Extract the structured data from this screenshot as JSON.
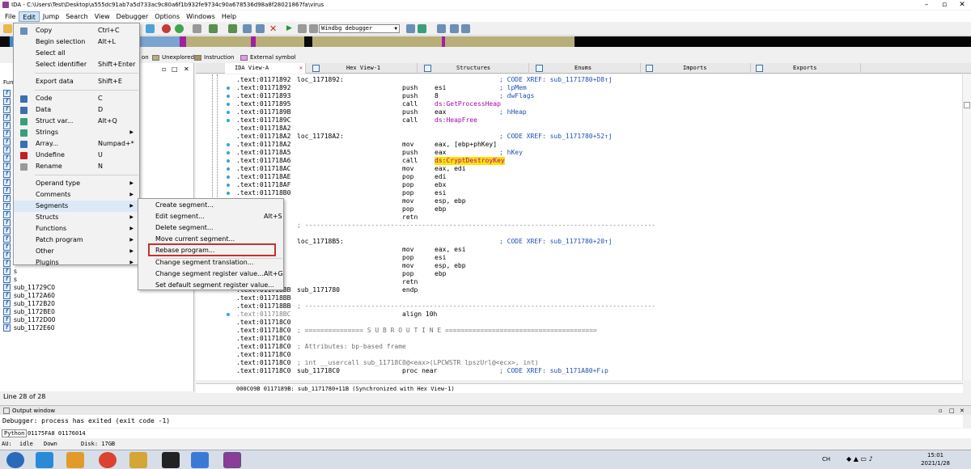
{
  "window": {
    "title": "IDA - C:\\Users\\Test\\Desktop\\a555dc91ab7a5d733ac9c80a6f1b932fe9734c90a678536d98a8f28021867fa\\virus"
  },
  "menubar": [
    "File",
    "Edit",
    "Jump",
    "Search",
    "View",
    "Debugger",
    "Options",
    "Windows",
    "Help"
  ],
  "toolbar": {
    "debugger_select": "Windbg debugger"
  },
  "legend": [
    "on",
    "Unexplored",
    "Instruction",
    "External symbol"
  ],
  "edit_menu": [
    {
      "label": "Copy",
      "shortcut": "Ctrl+C"
    },
    {
      "label": "Begin selection",
      "shortcut": "Alt+L"
    },
    {
      "label": "Select all",
      "shortcut": ""
    },
    {
      "label": "Select identifier",
      "shortcut": "Shift+Enter"
    },
    {
      "label": "Export data",
      "shortcut": "Shift+E"
    },
    {
      "label": "Code",
      "shortcut": "C"
    },
    {
      "label": "Data",
      "shortcut": "D"
    },
    {
      "label": "Struct var...",
      "shortcut": "Alt+Q"
    },
    {
      "label": "Strings",
      "shortcut": ""
    },
    {
      "label": "Array...",
      "shortcut": "Numpad+*"
    },
    {
      "label": "Undefine",
      "shortcut": "U"
    },
    {
      "label": "Rename",
      "shortcut": "N"
    },
    {
      "label": "Operand type",
      "shortcut": ""
    },
    {
      "label": "Comments",
      "shortcut": ""
    },
    {
      "label": "Segments",
      "shortcut": ""
    },
    {
      "label": "Structs",
      "shortcut": ""
    },
    {
      "label": "Functions",
      "shortcut": ""
    },
    {
      "label": "Patch program",
      "shortcut": ""
    },
    {
      "label": "Other",
      "shortcut": ""
    },
    {
      "label": "Plugins",
      "shortcut": ""
    }
  ],
  "segments_submenu": [
    {
      "label": "Create segment...",
      "shortcut": ""
    },
    {
      "label": "Edit segment...",
      "shortcut": "Alt+S"
    },
    {
      "label": "Delete segment...",
      "shortcut": ""
    },
    {
      "label": "Move current segment...",
      "shortcut": ""
    },
    {
      "label": "Rebase program...",
      "shortcut": ""
    },
    {
      "label": "Change segment translation...",
      "shortcut": ""
    },
    {
      "label": "Change segment register value...",
      "shortcut": "Alt+G"
    },
    {
      "label": "Set default segment register value...",
      "shortcut": ""
    }
  ],
  "functions_panel": {
    "header": "Func",
    "items": [
      "s",
      "s",
      "s",
      "s",
      "s",
      "s",
      "s",
      "s",
      "s",
      "s",
      "s",
      "s",
      "s",
      "s",
      "s",
      "s",
      "s",
      "s",
      "s",
      "s",
      "s",
      "s",
      "s",
      "s",
      "sub_11729C0",
      "sub_1172A60",
      "sub_1172B20",
      "sub_1172BE0",
      "sub_1172D00",
      "sub_1172E60"
    ],
    "status": "Line 28 of 28"
  },
  "tabs": [
    {
      "label": "IDA View-A"
    },
    {
      "label": "Hex View-1"
    },
    {
      "label": "Structures"
    },
    {
      "label": "Enums"
    },
    {
      "label": "Imports"
    },
    {
      "label": "Exports"
    }
  ],
  "code_lines": [
    {
      "addr": ".text:01171892",
      "label": "loc_1171892:",
      "mn": "",
      "op": "",
      "cm": "; CODE XREF: sub_1171780+D8↑j"
    },
    {
      "addr": ".text:01171892",
      "label": "",
      "mn": "push",
      "op": "esi",
      "cm": "; lpMem"
    },
    {
      "addr": ".text:01171893",
      "label": "",
      "mn": "push",
      "op": "8",
      "cm": "; dwFlags"
    },
    {
      "addr": ".text:01171895",
      "label": "",
      "mn": "call",
      "op": "ds:GetProcessHeap",
      "cm": ""
    },
    {
      "addr": ".text:0117189B",
      "label": "",
      "mn": "push",
      "op": "eax",
      "cm": "; hHeap"
    },
    {
      "addr": ".text:0117189C",
      "label": "",
      "mn": "call",
      "op": "ds:HeapFree",
      "cm": ""
    },
    {
      "addr": ".text:011718A2",
      "label": "",
      "mn": "",
      "op": "",
      "cm": ""
    },
    {
      "addr": ".text:011718A2",
      "label": "loc_11718A2:",
      "mn": "",
      "op": "",
      "cm": "; CODE XREF: sub_1171780+52↑j"
    },
    {
      "addr": ".text:011718A2",
      "label": "",
      "mn": "mov",
      "op": "eax, [ebp+phKey]",
      "cm": ""
    },
    {
      "addr": ".text:011718A5",
      "label": "",
      "mn": "push",
      "op": "eax",
      "cm": "; hKey"
    },
    {
      "addr": ".text:011718A6",
      "label": "",
      "mn": "call",
      "op": "ds:CryptDestroyKey",
      "cm": ""
    },
    {
      "addr": ".text:011718AC",
      "label": "",
      "mn": "mov",
      "op": "eax, edi",
      "cm": ""
    },
    {
      "addr": ".text:011718AE",
      "label": "",
      "mn": "pop",
      "op": "edi",
      "cm": ""
    },
    {
      "addr": ".text:011718AF",
      "label": "",
      "mn": "pop",
      "op": "ebx",
      "cm": ""
    },
    {
      "addr": ".text:011718B0",
      "label": "",
      "mn": "pop",
      "op": "esi",
      "cm": ""
    },
    {
      "addr": "",
      "label": "",
      "mn": "mov",
      "op": "esp, ebp",
      "cm": ""
    },
    {
      "addr": "",
      "label": "",
      "mn": "pop",
      "op": "ebp",
      "cm": ""
    },
    {
      "addr": "",
      "label": "",
      "mn": "retn",
      "op": "",
      "cm": ""
    },
    {
      "addr": "",
      "label": "; ------------------------------------------------------------------------------------------",
      "mn": "",
      "op": "",
      "cm": ""
    },
    {
      "addr": "",
      "label": "",
      "mn": "",
      "op": "",
      "cm": ""
    },
    {
      "addr": "",
      "label": "loc_11718B5:",
      "mn": "",
      "op": "",
      "cm": "; CODE XREF: sub_1171780+20↑j"
    },
    {
      "addr": "",
      "label": "",
      "mn": "mov",
      "op": "eax, esi",
      "cm": ""
    },
    {
      "addr": "",
      "label": "",
      "mn": "pop",
      "op": "esi",
      "cm": ""
    },
    {
      "addr": "",
      "label": "",
      "mn": "mov",
      "op": "esp, ebp",
      "cm": ""
    },
    {
      "addr": "",
      "label": "",
      "mn": "pop",
      "op": "ebp",
      "cm": ""
    },
    {
      "addr": "",
      "label": "",
      "mn": "retn",
      "op": "",
      "cm": ""
    },
    {
      "addr": ".text:011718BB",
      "label": "sub_1171780",
      "mn": "endp",
      "op": "",
      "cm": ""
    },
    {
      "addr": ".text:011718BB",
      "label": "",
      "mn": "",
      "op": "",
      "cm": ""
    },
    {
      "addr": ".text:011718BB",
      "label": "; ------------------------------------------------------------------------------------------",
      "mn": "",
      "op": "",
      "cm": ""
    },
    {
      "addr": ".text:011718BC",
      "label": "",
      "mn": "align 10h",
      "op": "",
      "cm": ""
    },
    {
      "addr": ".text:011718C0",
      "label": "",
      "mn": "",
      "op": "",
      "cm": ""
    },
    {
      "addr": ".text:011718C0",
      "label": "; =============== S U B R O U T I N E =======================================",
      "mn": "",
      "op": "",
      "cm": ""
    },
    {
      "addr": ".text:011718C0",
      "label": "",
      "mn": "",
      "op": "",
      "cm": ""
    },
    {
      "addr": ".text:011718C0",
      "label": "; Attributes: bp-based frame",
      "mn": "",
      "op": "",
      "cm": ""
    },
    {
      "addr": ".text:011718C0",
      "label": "",
      "mn": "",
      "op": "",
      "cm": ""
    },
    {
      "addr": ".text:011718C0",
      "label": "; int __usercall sub_11718C0@<eax>(LPCWSTR lpszUrl@<ecx>, int)",
      "mn": "",
      "op": "",
      "cm": ""
    },
    {
      "addr": ".text:011718C0",
      "label": "sub_11718C0",
      "mn": "proc near",
      "op": "",
      "cm": "; CODE XREF: sub_1171A80+F↓p"
    }
  ],
  "code_status": "000C09B 0117189B: sub_1171780+11B (Synchronized with Hex View-1)",
  "output": {
    "title": "Output window",
    "text": "Debugger: process has exited (exit code -1)",
    "python_label": "Python",
    "python_text": "01175FA8 01176014"
  },
  "statusbar": {
    "au": "AU:",
    "state": "idle",
    "dir": "Down",
    "disk": "Disk: 17GB"
  },
  "taskbar": {
    "time": "15:01",
    "date": "2021/1/28",
    "lang": "CH"
  }
}
